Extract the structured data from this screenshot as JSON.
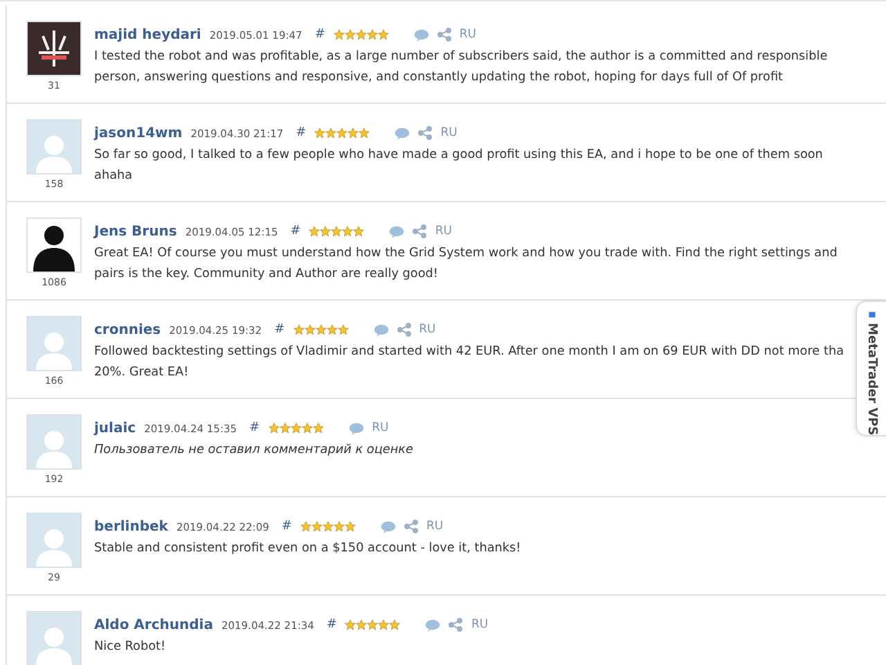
{
  "reviews": [
    {
      "name": "majid heydari",
      "date": "2019.05.01 19:47",
      "hash": "#",
      "stars": 5,
      "reply": true,
      "share": true,
      "lang": "RU",
      "kind": "photo",
      "count": "31",
      "italic": false,
      "text": "I tested the robot and was profitable, as a large number of subscribers said, the author is a committed and responsible person, answering questions and responsive, and constantly updating the robot, hoping for days full of Of profit"
    },
    {
      "name": "jason14wm",
      "date": "2019.04.30 21:17",
      "hash": "#",
      "stars": 5,
      "reply": true,
      "share": true,
      "lang": "RU",
      "kind": "default",
      "count": "158",
      "italic": false,
      "text": "So far so good, I talked to a few people who have made a good profit using this EA, and i hope to be one of them soon ahaha"
    },
    {
      "name": "Jens Bruns",
      "date": "2019.04.05 12:15",
      "hash": "#",
      "stars": 5,
      "reply": true,
      "share": true,
      "lang": "RU",
      "kind": "dark",
      "count": "1086",
      "italic": false,
      "text": "Great EA! Of course you must understand how the Grid System work and how you trade with. Find the right settings and pairs is the key. Community and Author are really good!"
    },
    {
      "name": "cronnies",
      "date": "2019.04.25 19:32",
      "hash": "#",
      "stars": 5,
      "reply": true,
      "share": true,
      "lang": "RU",
      "kind": "default",
      "count": "166",
      "italic": false,
      "text": "Followed backtesting settings of Vladimir and started with 42 EUR. After one month I am on 69 EUR with DD not more tha 20%. Great EA!"
    },
    {
      "name": "julaic",
      "date": "2019.04.24 15:35",
      "hash": "#",
      "stars": 5,
      "reply": true,
      "share": false,
      "lang": "RU",
      "kind": "default",
      "count": "192",
      "italic": true,
      "text": "Пользователь не оставил комментарий к оценке"
    },
    {
      "name": "berlinbek",
      "date": "2019.04.22 22:09",
      "hash": "#",
      "stars": 5,
      "reply": true,
      "share": true,
      "lang": "RU",
      "kind": "default",
      "count": "29",
      "italic": false,
      "text": "Stable and consistent profit even on a $150 account - love it, thanks!"
    },
    {
      "name": "Aldo Archundia",
      "date": "2019.04.22 21:34",
      "hash": "#",
      "stars": 5,
      "reply": true,
      "share": true,
      "lang": "RU",
      "kind": "default",
      "italic": false,
      "text": "Nice Robot!"
    }
  ],
  "side_tab": {
    "label": "MetaTrader VPS"
  }
}
